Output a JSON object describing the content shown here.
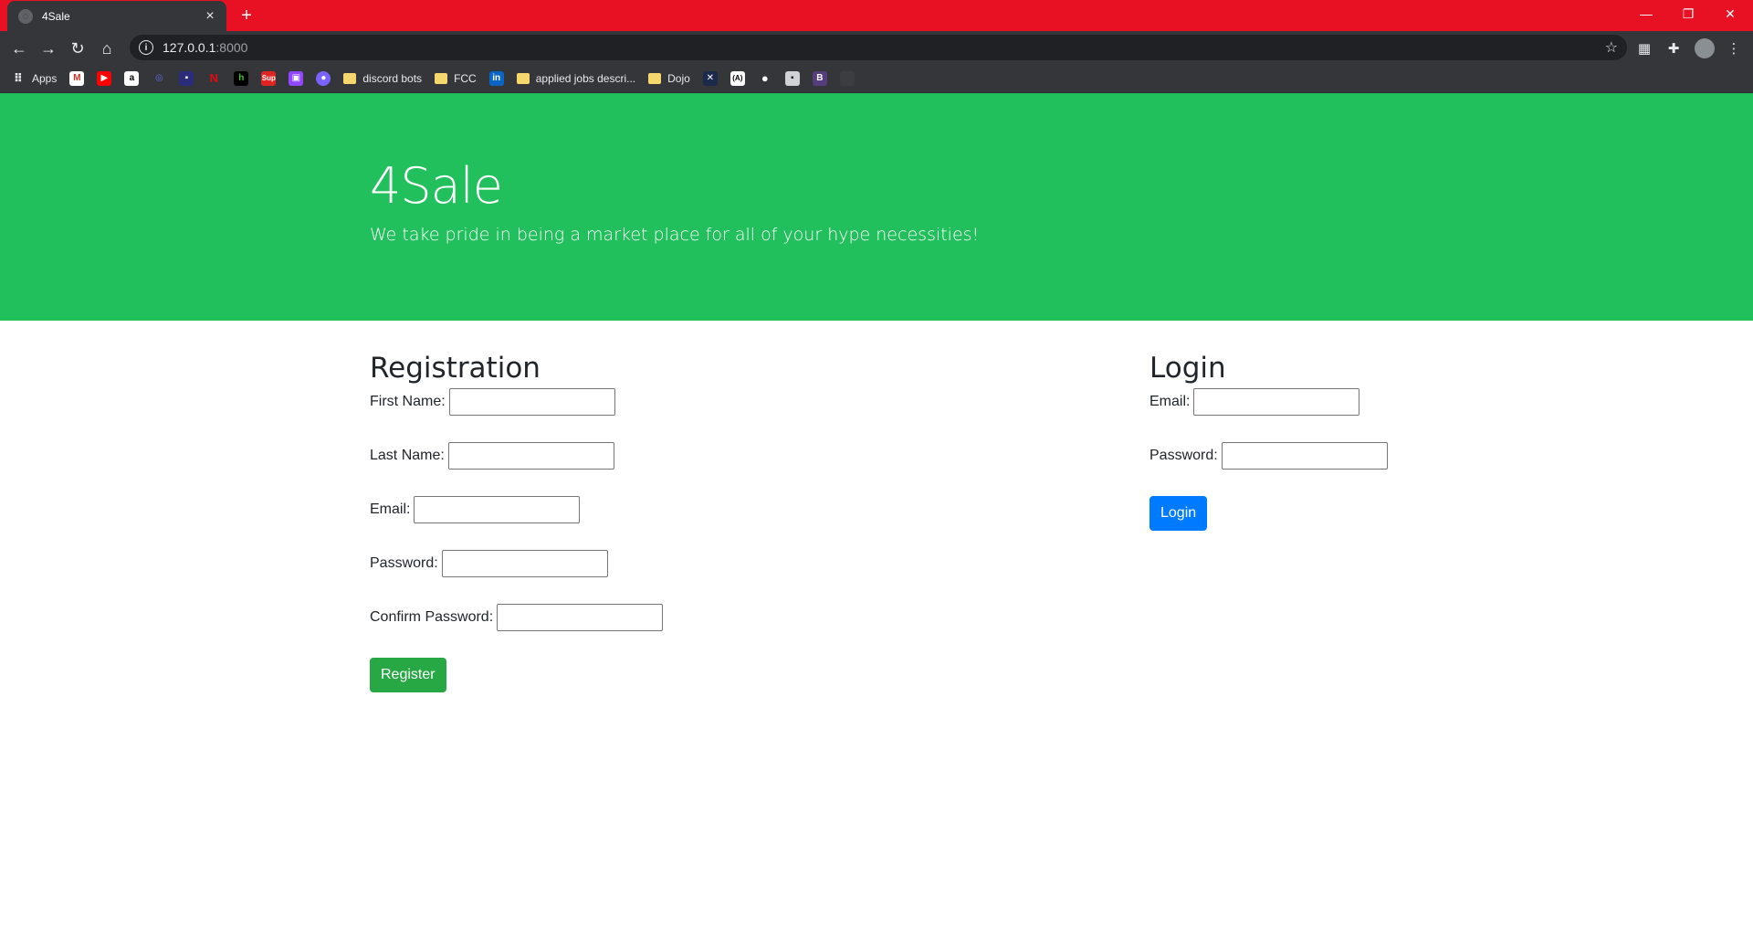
{
  "browser": {
    "tab_title": "4Sale",
    "url_host": "127.0.0.1",
    "url_port": ":8000",
    "bookmarks": {
      "apps": "Apps",
      "discord_bots": "discord bots",
      "fcc": "FCC",
      "applied_jobs": "applied jobs descri...",
      "dojo": "Dojo"
    }
  },
  "hero": {
    "title": "4Sale",
    "tagline": "We take pride in being a market place for all of your hype necessities!",
    "bg_color": "#21c05c"
  },
  "registration": {
    "heading": "Registration",
    "first_name_label": "First Name:",
    "last_name_label": "Last Name:",
    "email_label": "Email:",
    "password_label": "Password:",
    "confirm_password_label": "Confirm Password:",
    "first_name_value": "",
    "last_name_value": "",
    "email_value": "",
    "password_value": "",
    "confirm_password_value": "",
    "register_label": "Register",
    "register_color": "#28a745"
  },
  "login": {
    "heading": "Login",
    "email_label": "Email:",
    "password_label": "Password:",
    "email_value": "",
    "password_value": "",
    "login_label": "Login",
    "login_color": "#007bff"
  }
}
